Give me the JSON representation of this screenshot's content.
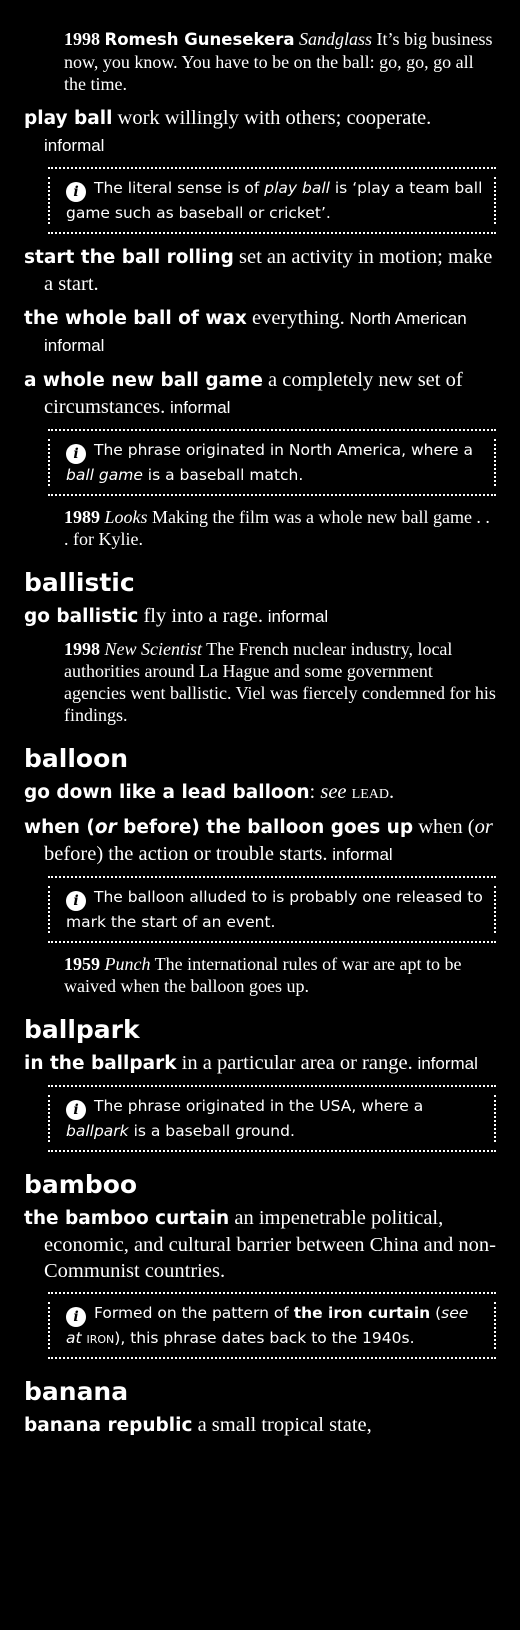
{
  "items": [
    {
      "kind": "quote",
      "yr": "1998",
      "src_b": "Romesh Gunesekera",
      "src_i": "Sandglass",
      "text": " It’s big business now, you know. You have to be on the ball: go, go, go all the time."
    },
    {
      "kind": "entry",
      "phrase": "play ball",
      "def": " work willingly with others; cooperate.",
      "reg": " informal"
    },
    {
      "kind": "note",
      "html": "The literal sense is of <i>play ball</i> is ‘play a team ball game such as baseball or cricket’."
    },
    {
      "kind": "entry",
      "phrase": "start the ball rolling",
      "def": " set an activity in motion; make a start.",
      "reg": ""
    },
    {
      "kind": "entry",
      "phrase": "the whole ball of wax",
      "def": " everything.",
      "reg": " North American informal"
    },
    {
      "kind": "entry",
      "phrase": "a whole new ball game",
      "def": " a completely new set of circumstances.",
      "reg": " informal"
    },
    {
      "kind": "note",
      "html": "The phrase originated in North America, where a <i>ball game</i> is a baseball match."
    },
    {
      "kind": "quote",
      "yr": "1989",
      "src_i": "Looks",
      "text": " Making the film was a whole new ball game . . . for Kylie."
    },
    {
      "kind": "hw",
      "text": "ballistic"
    },
    {
      "kind": "entry",
      "phrase": "go ballistic",
      "def": " fly into a rage.",
      "reg": " informal"
    },
    {
      "kind": "quote",
      "yr": "1998",
      "src_i": "New Scientist",
      "text": " The French nuclear industry, local authorities around La Hague and some government agencies went ballistic. Viel was fiercely condemned for his findings."
    },
    {
      "kind": "hw",
      "text": "balloon"
    },
    {
      "kind": "entry",
      "phrase": "go down like a lead balloon",
      "def": ": <i>see</i> <span class=\"sc\">lead</span>.",
      "reg": ""
    },
    {
      "kind": "entry",
      "phrase": "when (<i>or</i> before) the balloon goes up",
      "def": " when (<i>or</i> before) the action or trouble starts.",
      "reg": " informal"
    },
    {
      "kind": "note",
      "html": "The balloon alluded to is probably one released to mark the start of an event."
    },
    {
      "kind": "quote",
      "yr": "1959",
      "src_i": "Punch",
      "text": " The international rules of war are apt to be waived when the balloon goes up."
    },
    {
      "kind": "hw",
      "text": "ballpark"
    },
    {
      "kind": "entry",
      "phrase": "in the ballpark",
      "def": " in a particular area or range.",
      "reg": " informal"
    },
    {
      "kind": "note",
      "html": "The phrase originated in the USA, where a <i>ballpark</i> is a baseball ground."
    },
    {
      "kind": "hw",
      "text": "bamboo"
    },
    {
      "kind": "entry",
      "phrase": "the bamboo curtain",
      "def": " an impenetrable political, economic, and cultural barrier between China and non-Communist countries.",
      "reg": ""
    },
    {
      "kind": "note",
      "html": "Formed on the pattern of <b>the iron curtain</b> (<i>see at</i> <span class=\"sc\">iron</span>), this phrase dates back to the 1940s."
    },
    {
      "kind": "hw",
      "text": "banana"
    },
    {
      "kind": "entry",
      "phrase": "banana republic",
      "def": " a small tropical state,",
      "reg": ""
    }
  ]
}
